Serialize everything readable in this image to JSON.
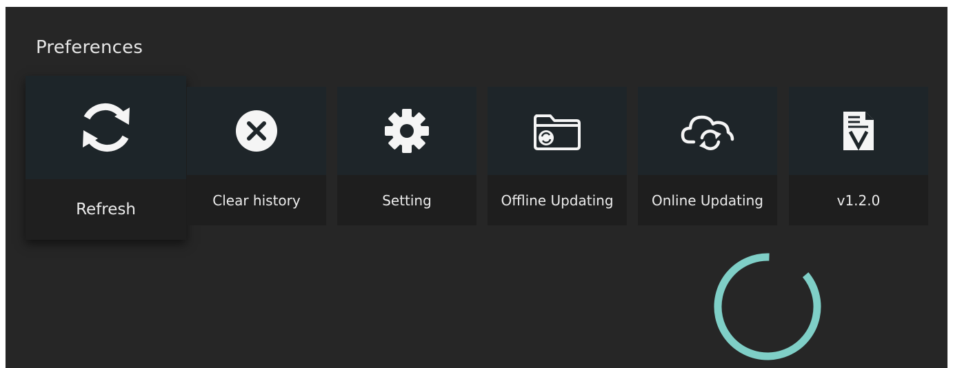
{
  "header": {
    "title": "Preferences"
  },
  "tiles": [
    {
      "label": "Refresh",
      "icon": "refresh-icon",
      "focused": true
    },
    {
      "label": "Clear history",
      "icon": "clear-circle-icon"
    },
    {
      "label": "Setting",
      "icon": "gear-icon"
    },
    {
      "label": "Offline Updating",
      "icon": "folder-sync-icon"
    },
    {
      "label": "Online Updating",
      "icon": "cloud-sync-icon"
    },
    {
      "label": "v1.2.0",
      "icon": "version-document-icon"
    }
  ],
  "colors": {
    "background": "#262626",
    "tile_top": "#1e2529",
    "tile_bottom": "#1e1e1e",
    "spinner": "#7fcfc7"
  },
  "loading_indicator": {
    "icon": "loading-spinner"
  }
}
